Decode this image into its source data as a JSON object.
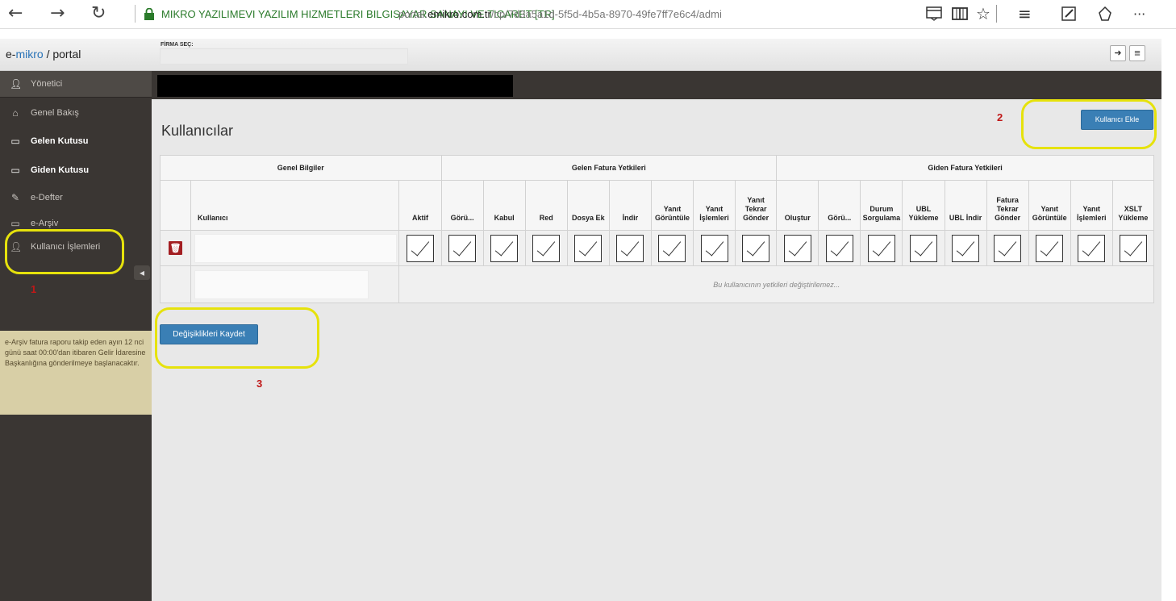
{
  "browser": {
    "back_icon": "←",
    "forward_icon": "→",
    "refresh_icon": "↻",
    "site_name": "MIKRO YAZILIMEVI YAZILIM HIZMETLERI BILGISAYAR SANAYI VE TICARET [TR]",
    "url_prefix": "portal.",
    "url_domain": "emikro.com.tr",
    "url_rest": "/cp/7d3a5a1d-5f5d-4b5a-8970-49fe7ff7e6c4/admi",
    "more_icon": "···"
  },
  "header": {
    "brand_e": "e-",
    "brand_mikro": "mikro",
    "brand_rest": " / portal",
    "firma_label": "FİRMA SEÇ:"
  },
  "sidebar": {
    "user_label": "Yönetici",
    "items": [
      {
        "label": "Genel Bakış",
        "icon": "home-icon"
      },
      {
        "label": "Gelen Kutusu",
        "icon": "inbox-icon"
      },
      {
        "label": "Giden Kutusu",
        "icon": "inbox-icon"
      },
      {
        "label": "e-Defter",
        "icon": "edit-icon"
      },
      {
        "label": "e-Arşiv",
        "icon": "inbox-icon"
      },
      {
        "label": "Kullanıcı İşlemleri",
        "icon": "user-icon"
      }
    ],
    "note": "e-Arşiv fatura raporu takip eden ayın 12 nci günü saat 00:00'dan itibaren Gelir İdaresine Başkanlığına gönderilmeye başlanacaktır."
  },
  "main": {
    "title": "Kullanıcılar",
    "add_user_label": "Kullanıcı Ekle",
    "save_label": "Değişiklikleri Kaydet",
    "locked_message": "Bu kullanıcının yetkileri değiştirilemez..."
  },
  "table": {
    "groups": [
      "Genel Bilgiler",
      "Gelen Fatura Yetkileri",
      "Giden Fatura Yetkileri"
    ],
    "columns": [
      "Kullanıcı",
      "Aktif",
      "Görü...",
      "Kabul",
      "Red",
      "Dosya Ek",
      "İndir",
      "Yanıt Görüntüle",
      "Yanıt İşlemleri",
      "Yanıt Tekrar Gönder",
      "Oluştur",
      "Görü...",
      "Durum Sorgulama",
      "UBL Yükleme",
      "UBL İndir",
      "Fatura Tekrar Gönder",
      "Yanıt Görüntüle",
      "Yanıt İşlemleri",
      "XSLT Yükleme"
    ],
    "row1_checked": [
      true,
      true,
      true,
      true,
      true,
      true,
      true,
      true,
      true,
      true,
      true,
      true,
      true,
      true,
      true,
      true,
      true,
      true
    ]
  },
  "annotations": [
    "1",
    "2",
    "3"
  ],
  "colors": {
    "sidebar_bg": "#3a3633",
    "primary_button": "#3a7fb5",
    "delete_button": "#a31e22",
    "callout": "#e6e20c",
    "callout_number": "#c01818"
  }
}
